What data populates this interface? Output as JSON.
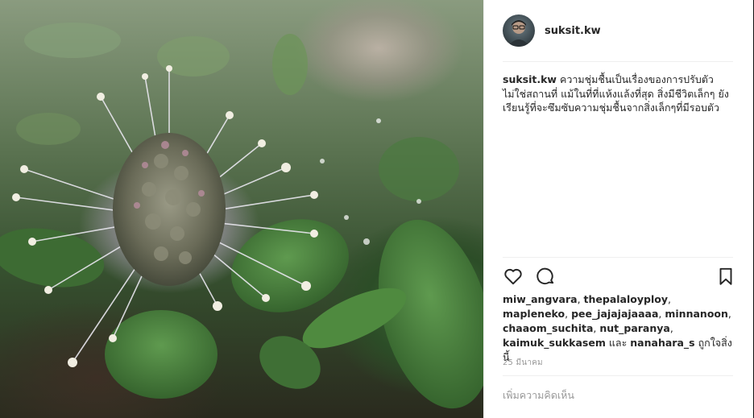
{
  "post": {
    "username": "suksit.kw",
    "caption_user": "suksit.kw",
    "caption_text": "ความชุ่มชื้นเป็นเรื่องของการปรับตัว ไม่ใช่สถานที่ แม้ในที่ที่แห้งแล้งที่สุด สิ่งมีชีวิตเล็กๆ ยังเรียนรู้ที่จะซึมซับความชุ่มชื้นจากสิ่งเล็กๆที่มีรอบตัว",
    "likes": {
      "users": [
        "miw_angvara",
        "thepalaloyploy",
        "mapleneko",
        "pee_jajajajaaaa",
        "minnanoon",
        "chaaom_suchita",
        "nut_paranya",
        "kaimuk_sukkasem",
        "nanahara_s"
      ],
      "and_word": "และ",
      "suffix": "ถูกใจสิ่งนี้"
    },
    "date": "25 มีนาคม",
    "comment_placeholder": "เพิ่มความคิดเห็น"
  },
  "icons": {
    "like": "heart-icon",
    "comment": "comment-icon",
    "save": "bookmark-icon"
  }
}
